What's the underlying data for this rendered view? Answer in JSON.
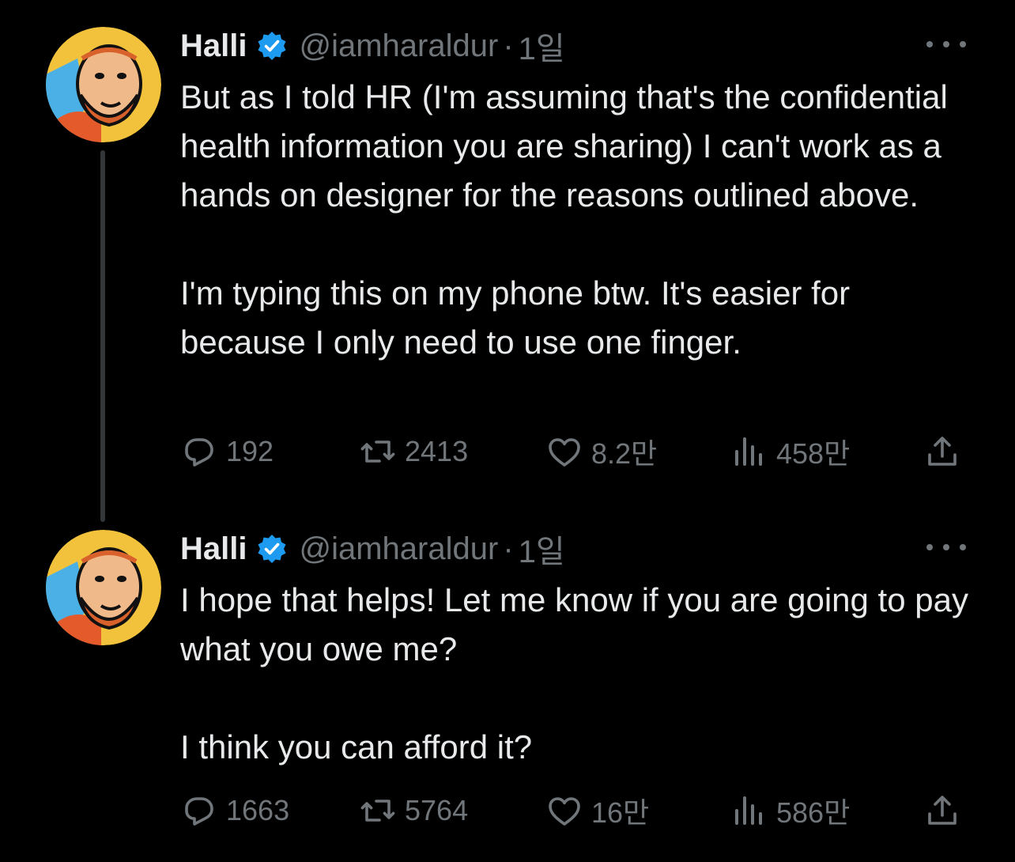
{
  "tweets": [
    {
      "author": {
        "name": "Halli",
        "handle": "@iamharaldur",
        "separator": "·",
        "time": "1일"
      },
      "paragraphs": [
        "But as I told HR (I'm assuming that's the confidential health information you are sharing) I can't work as a hands on designer for the reasons outlined above.",
        "I'm typing this on my phone btw. It's easier for because I only need to use one finger."
      ],
      "actions": {
        "replies": "192",
        "reposts": "2413",
        "likes": "8.2만",
        "views": "458만"
      }
    },
    {
      "author": {
        "name": "Halli",
        "handle": "@iamharaldur",
        "separator": "·",
        "time": "1일"
      },
      "paragraphs": [
        "I hope that helps! Let me know if you are going to pay what you owe me?",
        "I think you can afford it?"
      ],
      "actions": {
        "replies": "1663",
        "reposts": "5764",
        "likes": "16만",
        "views": "586만"
      }
    }
  ],
  "colors": {
    "background": "#000000",
    "text": "#e7e9ea",
    "muted": "#71767b",
    "verified": "#1d9bf0",
    "thread_line": "#333639"
  },
  "icons": [
    "reply-icon",
    "repost-icon",
    "like-icon",
    "views-icon",
    "share-icon",
    "verified-badge-icon",
    "more-icon"
  ]
}
